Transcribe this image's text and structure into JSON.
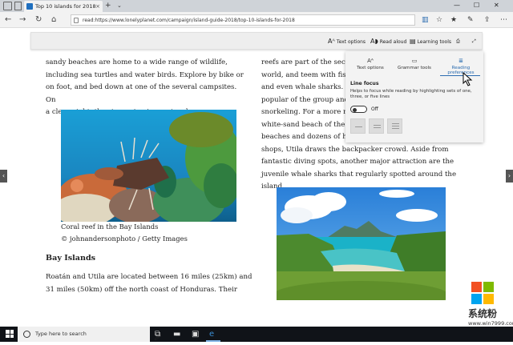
{
  "tabbar": {
    "tab_title": "Top 10 islands for 2018",
    "tab_close": "×",
    "new_tab": "+",
    "tab_menu": "⌄",
    "minimize": "—",
    "maximize": "☐",
    "close": "✕"
  },
  "navbar": {
    "back": "←",
    "forward": "→",
    "refresh": "↻",
    "home": "⌂",
    "url": "read:https://www.lonelyplanet.com/campaign/island-guide-2018/top-10-islands-for-2018"
  },
  "reader_toolbar": {
    "text_options": "Text options",
    "read_aloud": "Read aloud",
    "learning_tools": "Learning tools"
  },
  "article": {
    "left_paragraph": [
      "sandy beaches are home to a wide range of wildlife,",
      "including sea turtles and water birds. Explore by bike or",
      "on foot, and bed down at one of the several campsites. On",
      "a clear night, the stargazing is spectacular."
    ],
    "caption_line1": "Coral reef in the Bay Islands",
    "caption_line2": "© johnandersonphoto / Getty Images",
    "heading": "Bay Islands",
    "left_paragraph2": [
      "Roatán and Utila are located between 16 miles (25km) and",
      "31 miles (50km) off the north coast of Honduras. Their"
    ],
    "right_paragraph": [
      "reefs are part of the secon",
      "world, and teem with fish",
      "and even whale sharks. Ro",
      "popular of the group and i",
      "snorkeling. For a more rel",
      "white-sand beach of the W",
      "beaches and dozens of hot",
      "shops, Utila draws the backpacker crowd. Aside from",
      "fantastic diving spots, another major attraction are the",
      "juvenile whale sharks that regularly spotted around the",
      "island."
    ]
  },
  "learning_panel": {
    "tabs": [
      {
        "label": "Text options",
        "icon": "Aᴬ"
      },
      {
        "label": "Grammar tools",
        "icon": "▭"
      },
      {
        "label": "Reading preferences",
        "icon": "≣"
      }
    ],
    "section_title": "Line focus",
    "description": "Helps to focus while reading by highlighting sets of one, three, or five lines",
    "toggle_state": "Off"
  },
  "taskbar": {
    "search_placeholder": "Type here to search"
  },
  "watermark": {
    "title": "系统粉",
    "url": "www.win7999.com"
  }
}
